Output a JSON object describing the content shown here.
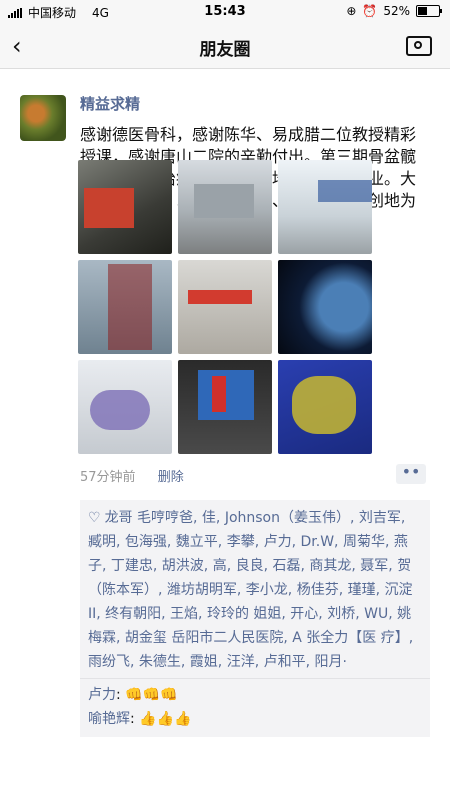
{
  "status": {
    "carrier": "中国移动",
    "network": "4G",
    "time": "15:43",
    "battery": "52%",
    "battery_level": 0.52
  },
  "nav": {
    "title": "朋友圈",
    "back_icon": "chevron-left-icon",
    "camera_icon": "camera-icon"
  },
  "post": {
    "author": "精益求精",
    "text": "感谢德医骨科，感谢陈华、易成腊二位教授精彩授课，感谢唐山二院的辛勤付出。第三期骨盆髋臼骨折微创治疗技术及解剖培训班顺利结业。大家收获多多。以后可以更快、更好、更微创地为人民服务。",
    "time": "57分钟前",
    "delete_label": "删除",
    "more_label": "••",
    "likes": "龙哥 毛哼哼爸, 佳, Johnson（姜玉伟）, 刘吉军, 臧明, 包海强, 魏立平, 李攀, 卢力, Dr.W, 周菊华, 燕子, 丁建忠, 胡洪波, 高, 良良, 石磊, 商其龙, 聂军, 贺（陈本军）, 潍坊胡明军, 李小龙, 杨佳芬, 瑾瑾, 沉淀 II, 终有朝阳, 王焰, 玲玲的 姐姐, 开心, 刘桥, WU, 姚梅霖, 胡金玺  岳阳市二人民医院, A 张全力【医 疗】, 雨纷飞, 朱德生, 霞姐, 汪洋, 卢和平, 阳月·",
    "comments": [
      {
        "name": "卢力",
        "sep": ": ",
        "text": "👊👊👊"
      },
      {
        "name": "喻艳辉",
        "sep": ": ",
        "text": "👍👍👍"
      }
    ]
  },
  "colors": {
    "link": "#576b95",
    "nav_bg": "#f7f7f7",
    "likes_bg": "#f3f3f5"
  }
}
